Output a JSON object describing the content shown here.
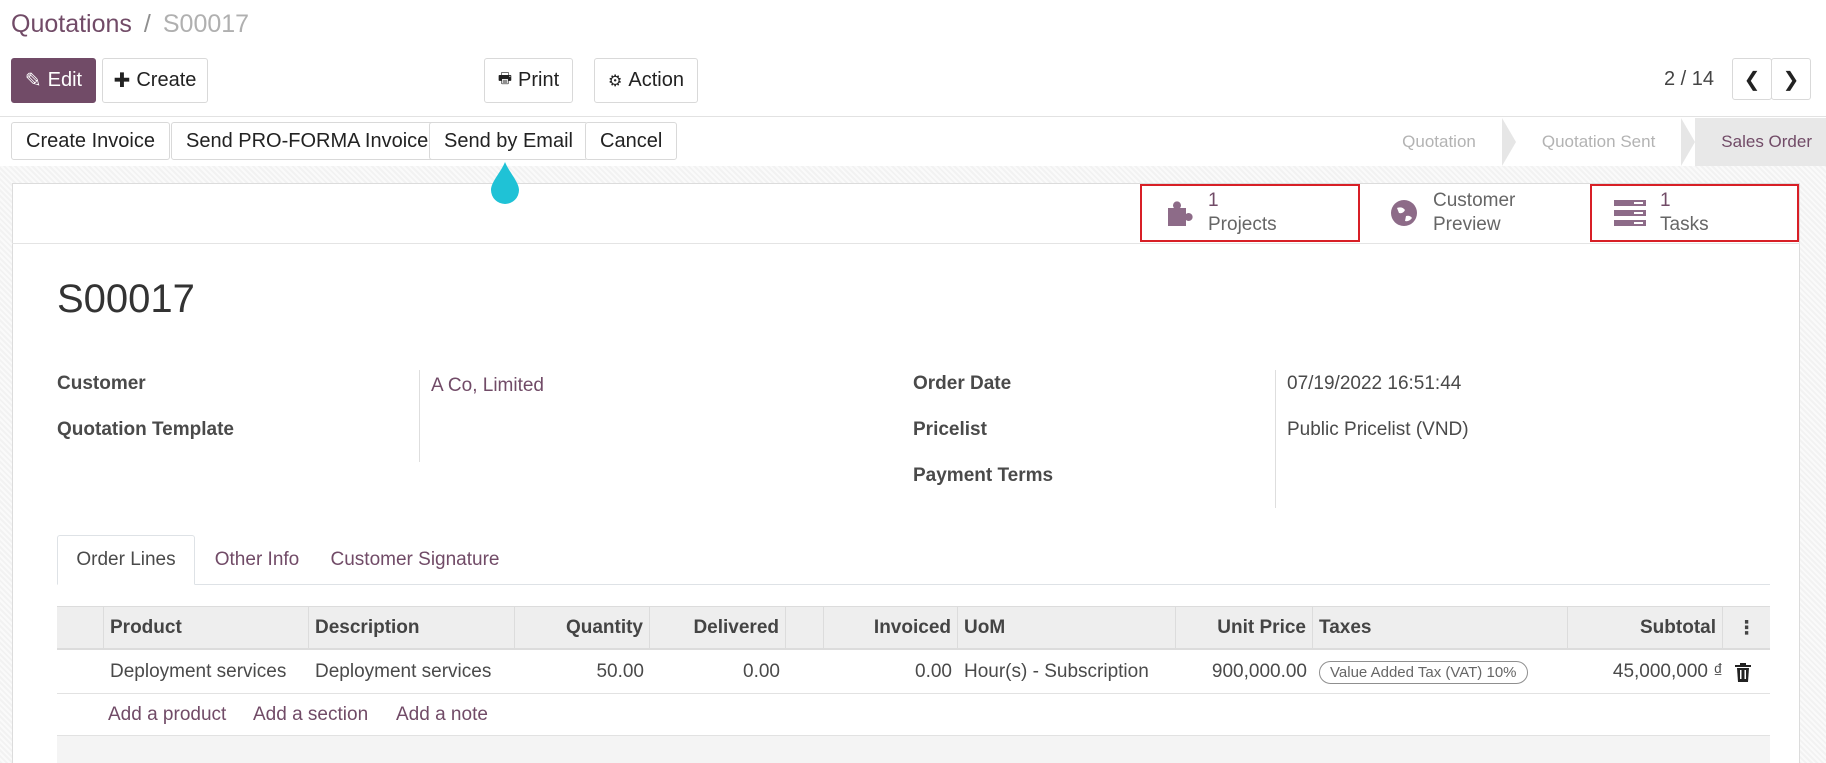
{
  "breadcrumb": {
    "parent": "Quotations",
    "separator": "/",
    "current": "S00017"
  },
  "toolbar": {
    "edit": "Edit",
    "create": "Create",
    "print": "Print",
    "action": "Action"
  },
  "pager": {
    "text": "2 / 14"
  },
  "actions": {
    "create_invoice": "Create Invoice",
    "send_proforma": "Send PRO-FORMA Invoice",
    "send_email": "Send by Email",
    "cancel": "Cancel"
  },
  "stages": {
    "quotation": "Quotation",
    "sent": "Quotation Sent",
    "order": "Sales Order"
  },
  "smart_buttons": {
    "projects": {
      "count": "1",
      "label": "Projects"
    },
    "preview": {
      "line1": "Customer",
      "line2": "Preview"
    },
    "tasks": {
      "count": "1",
      "label": "Tasks"
    }
  },
  "record": {
    "name": "S00017"
  },
  "fields": {
    "customer_label": "Customer",
    "customer_value": "A Co, Limited",
    "template_label": "Quotation Template",
    "order_date_label": "Order Date",
    "order_date_value": "07/19/2022 16:51:44",
    "pricelist_label": "Pricelist",
    "pricelist_value": "Public Pricelist (VND)",
    "payment_terms_label": "Payment Terms"
  },
  "tabs": {
    "order_lines": "Order Lines",
    "other_info": "Other Info",
    "signature": "Customer Signature"
  },
  "table": {
    "headers": {
      "product": "Product",
      "description": "Description",
      "quantity": "Quantity",
      "delivered": "Delivered",
      "invoiced": "Invoiced",
      "uom": "UoM",
      "unit_price": "Unit Price",
      "taxes": "Taxes",
      "subtotal": "Subtotal"
    },
    "row": {
      "product": "Deployment services",
      "description": "Deployment services",
      "quantity": "50.00",
      "delivered": "0.00",
      "invoiced": "0.00",
      "uom": "Hour(s) - Subscription",
      "unit_price": "900,000.00",
      "tax": "Value Added Tax (VAT) 10%",
      "subtotal": "45,000,000 ₫"
    },
    "add": {
      "product": "Add a product",
      "section": "Add a section",
      "note": "Add a note"
    }
  },
  "colors": {
    "brand": "#714b67",
    "highlight": "#d81f26",
    "drop": "#1fc2d6"
  }
}
